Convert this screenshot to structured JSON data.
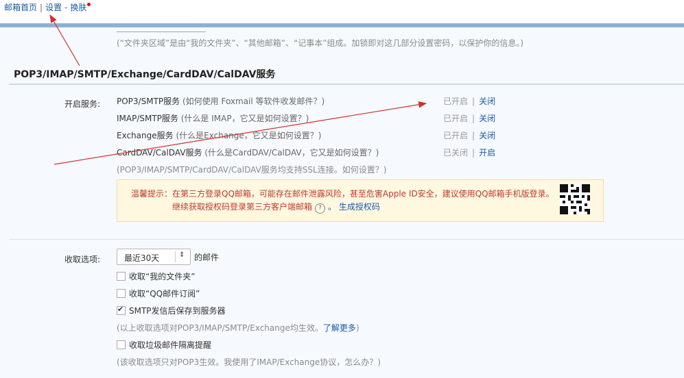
{
  "top_nav": {
    "home": "邮箱首页",
    "settings": "设置",
    "dash": "-",
    "skin": "换肤",
    "sep": "|"
  },
  "folder_note": "(“文件夹区域”是由“我的文件夹”、“其他邮箱”、“记事本”组成。加锁即对这几部分设置密码，以保护你的信息。)",
  "section_title": "POP3/IMAP/SMTP/Exchange/CardDAV/CalDAV服务",
  "services": {
    "label": "开启服务:",
    "items": [
      {
        "name": "POP3/SMTP服务",
        "help": "(如何使用 Foxmail 等软件收发邮件？)",
        "state": "已开启",
        "action": "关闭"
      },
      {
        "name": "IMAP/SMTP服务",
        "help": "(什么是 IMAP，它又是如何设置？)",
        "state": "已开启",
        "action": "关闭"
      },
      {
        "name": "Exchange服务",
        "help": "(什么是Exchange，它又是如何设置？)",
        "state": "已开启",
        "action": "关闭"
      },
      {
        "name": "CardDAV/CalDAV服务",
        "help": "(什么是CardDAV/CalDAV，它又是如何设置？)",
        "state": "已关闭",
        "action": "开启"
      }
    ],
    "separator": "|",
    "ssl_note": "(POP3/IMAP/SMTP/CardDAV/CalDAV服务均支持SSL连接。如何设置？)"
  },
  "tip": {
    "line1": "温馨提示：在第三方登录QQ邮箱，可能存在邮件泄露风险，甚至危害Apple ID安全，建议使用QQ邮箱手机版登录。",
    "line2": "继续获取授权码登录第三方客户端邮箱",
    "help_mark": "?",
    "link": "。 生成授权码"
  },
  "receive": {
    "label": "收取选项:",
    "select_value": "最近30天",
    "select_arrow": "⇕",
    "suffix": "的邮件",
    "options": [
      {
        "label": "收取“我的文件夹”",
        "checked": false
      },
      {
        "label": "收取“QQ邮件订阅”",
        "checked": false
      },
      {
        "label": "SMTP发信后保存到服务器",
        "checked": true
      }
    ],
    "note1": "(以上收取选项对POP3/IMAP/SMTP/Exchange均生效。",
    "note1_link": "了解更多",
    "note1_end": ")",
    "spam_option": {
      "label": "收取垃圾邮件隔离提醒",
      "checked": false
    },
    "note2": "(该收取选项只对POP3生效。我使用了IMAP/Exchange协议，怎么办？)"
  },
  "colors": {
    "annotation_arrow": "#d23030",
    "link": "#1a5aa8",
    "tip_text": "#c0392b"
  }
}
